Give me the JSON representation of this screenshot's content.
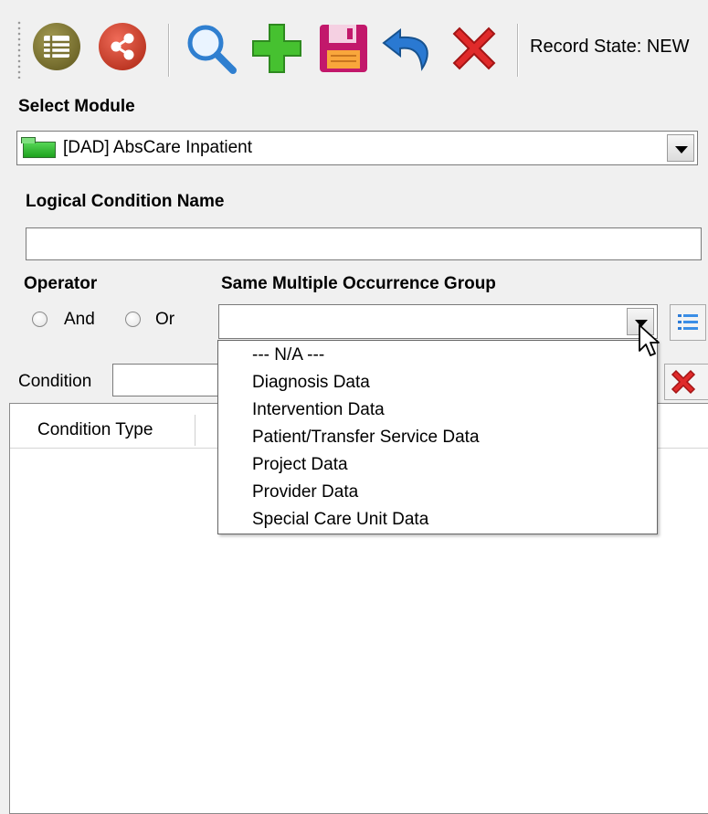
{
  "toolbar": {
    "icons": [
      "list-icon",
      "share-icon",
      "search-icon",
      "add-icon",
      "save-icon",
      "undo-icon",
      "delete-icon"
    ],
    "record_state": "Record State: NEW"
  },
  "module": {
    "label": "Select Module",
    "selected": "[DAD] AbsCare Inpatient"
  },
  "logical_condition": {
    "label": "Logical Condition Name",
    "value": ""
  },
  "operator": {
    "label": "Operator",
    "options": [
      "And",
      "Or"
    ]
  },
  "occurrence_group": {
    "label": "Same Multiple Occurrence Group",
    "value": "",
    "options": [
      "--- N/A ---",
      "Diagnosis Data",
      "Intervention Data",
      "Patient/Transfer Service Data",
      "Project Data",
      "Provider Data",
      "Special Care Unit Data"
    ]
  },
  "condition": {
    "label": "Condition",
    "value": ""
  },
  "grid": {
    "columns": [
      "Condition Type"
    ]
  },
  "colors": {
    "olive_button": "#7a7232",
    "share_red": "#d84a37",
    "add_green": "#3fbf2f",
    "save_magenta": "#c2186b",
    "undo_blue": "#2a6fc4",
    "delete_red": "#d42020"
  }
}
